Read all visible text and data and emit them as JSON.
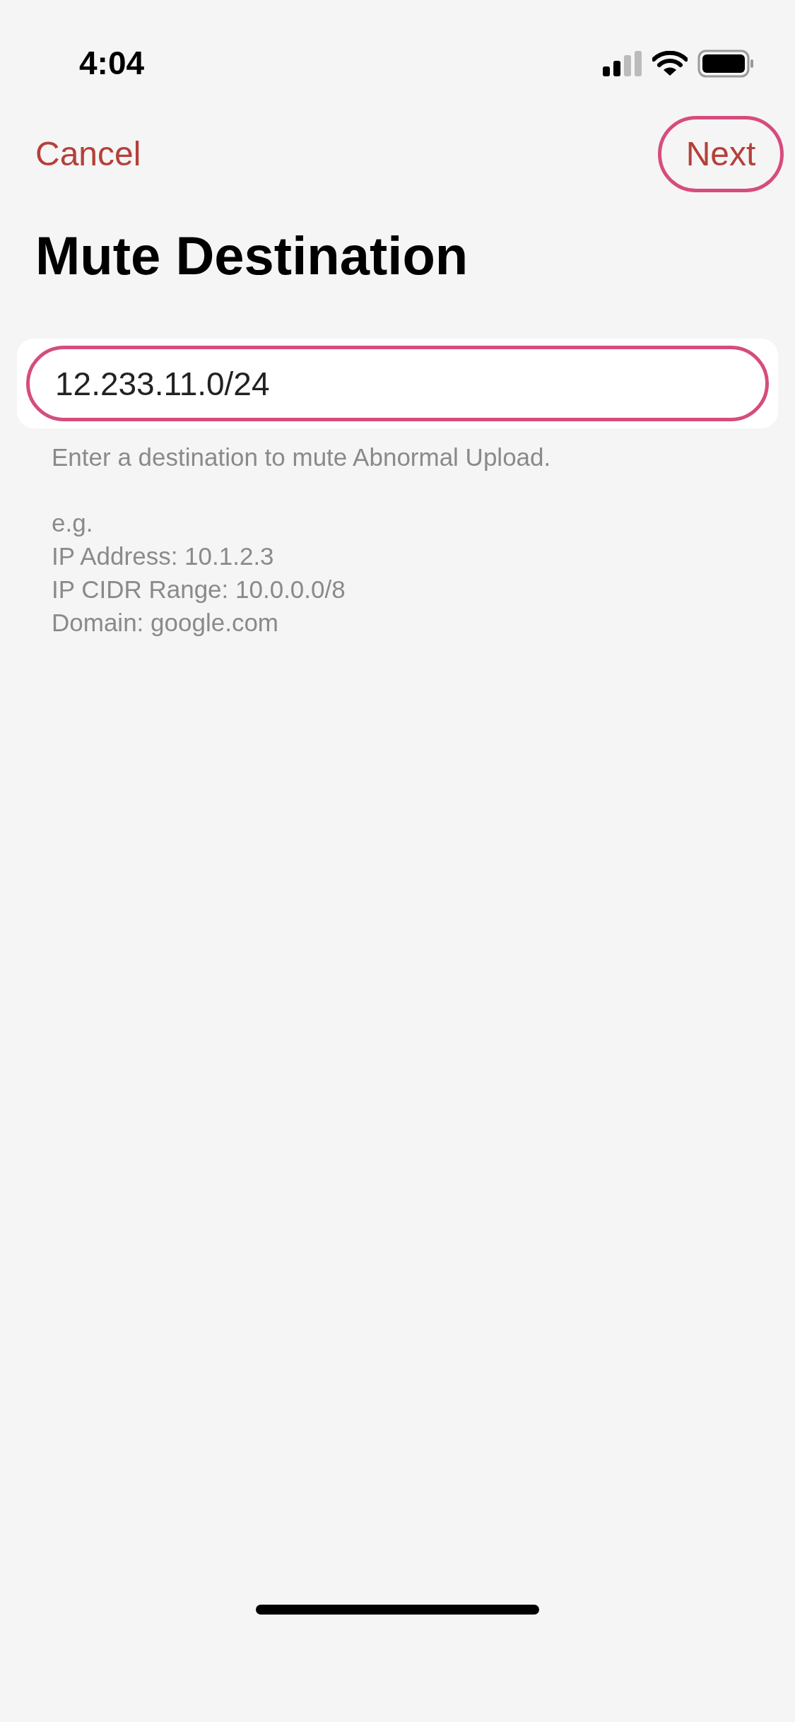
{
  "status_bar": {
    "time": "4:04"
  },
  "nav": {
    "cancel": "Cancel",
    "next": {
      "label": "Next",
      "highlighted": true
    }
  },
  "title": "Mute Destination",
  "field": {
    "value": "12.233.11.0/24",
    "highlighted": true
  },
  "hint": "Enter a destination to mute Abnormal Upload.",
  "examples": [
    "e.g.",
    "IP Address: 10.1.2.3",
    "IP CIDR Range: 10.0.0.0/8",
    "Domain: google.com"
  ]
}
